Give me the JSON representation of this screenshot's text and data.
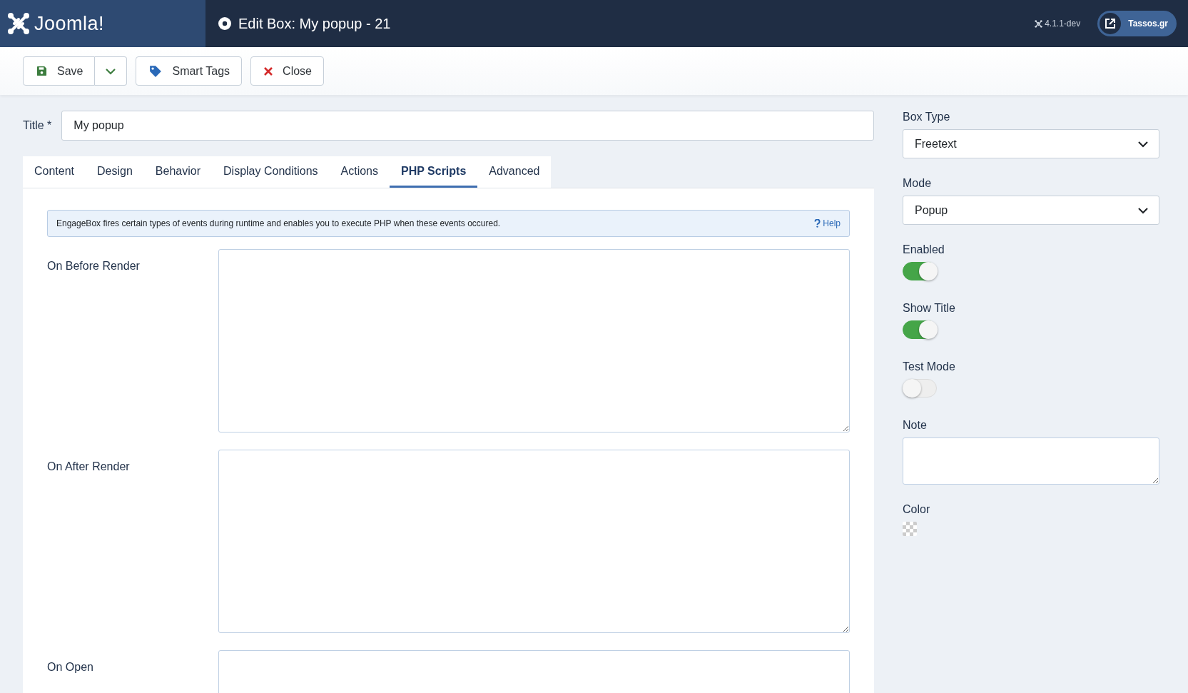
{
  "header": {
    "logo": "Joomla!",
    "title": "Edit Box: My popup - 21",
    "version": "4.1.1-dev",
    "site_link": "Tassos.gr"
  },
  "toolbar": [
    {
      "kind": "save",
      "label": "Save"
    },
    {
      "kind": "tags",
      "label": "Smart Tags"
    },
    {
      "kind": "close",
      "label": "Close"
    }
  ],
  "title_field": {
    "label": "Title *",
    "value": "My popup"
  },
  "tabs": [
    {
      "label": "Content",
      "selected": false
    },
    {
      "label": "Design",
      "selected": false
    },
    {
      "label": "Behavior",
      "selected": false
    },
    {
      "label": "Display Conditions",
      "selected": false
    },
    {
      "label": "Actions",
      "selected": false
    },
    {
      "label": "PHP Scripts",
      "selected": true
    },
    {
      "label": "Advanced",
      "selected": false
    }
  ],
  "alert": {
    "text": "EngageBox fires certain types of events during runtime and enables you to execute PHP when these events occured.",
    "help": "Help"
  },
  "scripts": [
    {
      "label": "On Before Render"
    },
    {
      "label": "On After Render"
    },
    {
      "label": "On Open"
    }
  ],
  "sidebar": [
    {
      "kind": "select",
      "label": "Box Type",
      "value": "Freetext"
    },
    {
      "kind": "select",
      "label": "Mode",
      "value": "Popup"
    },
    {
      "kind": "toggle",
      "label": "Enabled",
      "on": true
    },
    {
      "kind": "toggle",
      "label": "Show Title",
      "on": true
    },
    {
      "kind": "toggle",
      "label": "Test Mode",
      "on": false
    },
    {
      "kind": "textarea",
      "label": "Note"
    },
    {
      "kind": "color",
      "label": "Color"
    }
  ]
}
